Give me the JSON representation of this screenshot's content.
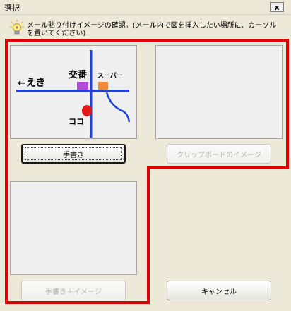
{
  "window": {
    "title": "選択",
    "close_label": "x"
  },
  "instruction": "メール貼り付けイメージの確認。(メール内で図を挿入したい場所に、カーソルを置いてください)",
  "sketch": {
    "labels": [
      "←えき",
      "交番",
      "スーパー",
      "ココ"
    ],
    "colors": {
      "road": "#1f3fe0",
      "police": "#b44ad8",
      "super": "#f08a3a",
      "here": "#e01818"
    }
  },
  "buttons": {
    "handwriting": "手書き",
    "clipboard_image": "クリップボードのイメージ",
    "handwriting_plus_image": "手書き＋イメージ",
    "cancel": "キャンセル"
  },
  "highlight_color": "#e00000"
}
